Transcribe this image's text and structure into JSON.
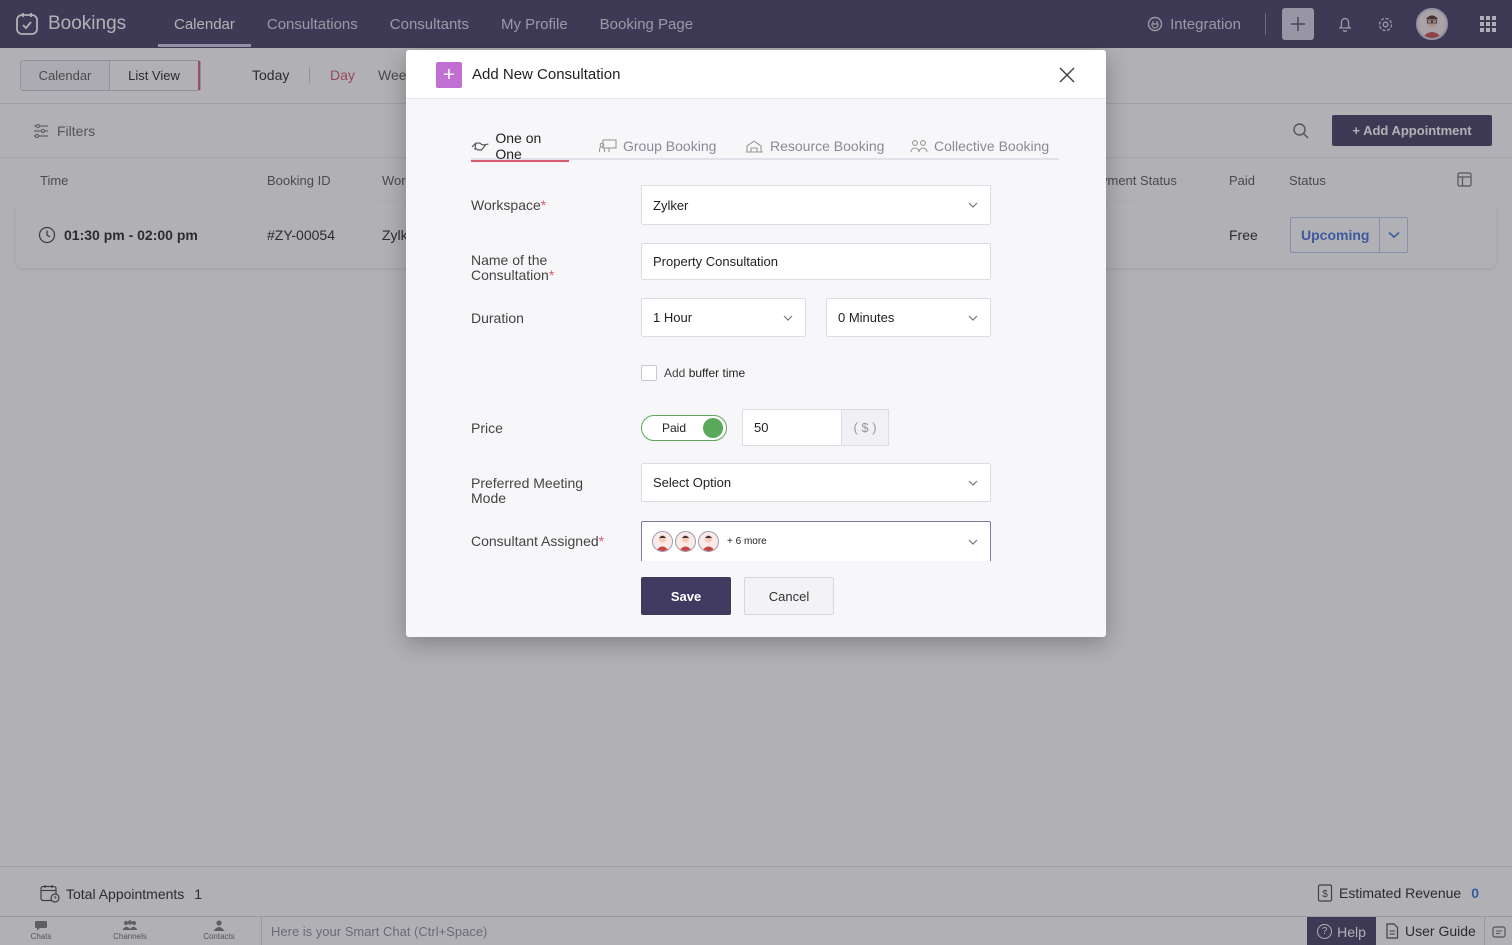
{
  "app": {
    "name": "Bookings"
  },
  "nav": {
    "items": [
      {
        "label": "Calendar",
        "active": true
      },
      {
        "label": "Consultations",
        "active": false
      },
      {
        "label": "Consultants",
        "active": false
      },
      {
        "label": "My Profile",
        "active": false
      },
      {
        "label": "Booking Page",
        "active": false
      }
    ],
    "integration": "Integration"
  },
  "toolbar": {
    "calendar_btn": "Calendar",
    "list_view_btn": "List View",
    "today": "Today",
    "day": "Day",
    "week": "Weel"
  },
  "filters": {
    "label": "Filters",
    "add_appointment": "+ Add Appointment"
  },
  "table": {
    "columns": [
      "Time",
      "Booking ID",
      "Wor",
      "yment Status",
      "Paid",
      "Status"
    ],
    "rows": [
      {
        "time": "01:30 pm - 02:00 pm",
        "booking_id": "#ZY-00054",
        "workspace": "Zylk",
        "paid": "Free",
        "status": "Upcoming"
      }
    ]
  },
  "summary": {
    "total_label": "Total Appointments",
    "total_value": "1",
    "revenue_label": "Estimated Revenue",
    "revenue_value": "0"
  },
  "chatbar": {
    "items": [
      "Chats",
      "Channels",
      "Contacts"
    ],
    "placeholder": "Here is your Smart Chat (Ctrl+Space)",
    "help": "Help",
    "guide": "User Guide"
  },
  "modal": {
    "title": "Add New Consultation",
    "tabs": [
      {
        "label": "One on One",
        "active": true
      },
      {
        "label": "Group Booking",
        "active": false
      },
      {
        "label": "Resource Booking",
        "active": false
      },
      {
        "label": "Collective Booking",
        "active": false
      }
    ],
    "workspace": {
      "label": "Workspace",
      "value": "Zylker"
    },
    "name": {
      "label_line1": "Name of the",
      "label_line2": "Consultation",
      "value": "Property Consultation"
    },
    "duration": {
      "label": "Duration",
      "hours": "1 Hour",
      "minutes": "0 Minutes"
    },
    "buffer": {
      "label_pre": "Add ",
      "label_bold": "buffer time",
      "checked": false
    },
    "price": {
      "label": "Price",
      "toggle_label": "Paid",
      "value": "50",
      "unit": "( $ )"
    },
    "meeting_mode": {
      "label_line1": "Preferred Meeting",
      "label_line2": "Mode",
      "value": "Select Option"
    },
    "consultant": {
      "label": "Consultant Assigned",
      "more": "+ 6 more"
    },
    "save": "Save",
    "cancel": "Cancel"
  },
  "colors": {
    "topbar": "#403a60",
    "accent": "#d95b6d",
    "link": "#3d6fd7",
    "toggle_on": "#5aa85a",
    "modal_icon": "#c26fd4"
  }
}
